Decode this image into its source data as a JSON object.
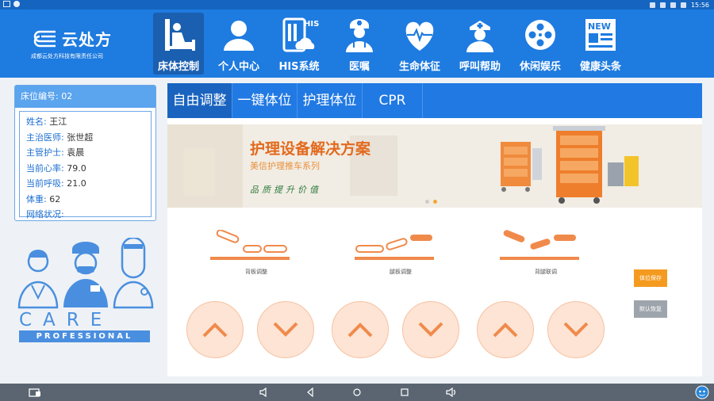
{
  "status_bar": {
    "time": "15:56"
  },
  "app": {
    "title": "云处方",
    "subtitle": "成都云处方科技有限责任公司"
  },
  "nav": [
    {
      "label": "床体控制",
      "icon": "bed-icon",
      "active": true
    },
    {
      "label": "个人中心",
      "icon": "user-icon",
      "active": false
    },
    {
      "label": "HIS系统",
      "icon": "his-icon",
      "active": false
    },
    {
      "label": "医嘱",
      "icon": "doctor-icon",
      "active": false
    },
    {
      "label": "生命体征",
      "icon": "heartbeat-icon",
      "active": false
    },
    {
      "label": "呼叫帮助",
      "icon": "nurse-icon",
      "active": false
    },
    {
      "label": "休闲娱乐",
      "icon": "film-reel-icon",
      "active": false
    },
    {
      "label": "健康头条",
      "icon": "news-icon",
      "active": false
    }
  ],
  "bed_info": {
    "header": "床位编号: 02",
    "rows": [
      {
        "key": "姓名:",
        "value": "王江"
      },
      {
        "key": "主治医师:",
        "value": "张世超"
      },
      {
        "key": "主管护士:",
        "value": "袁晨"
      },
      {
        "key": "当前心率:",
        "value": "79.0"
      },
      {
        "key": "当前呼吸:",
        "value": "21.0"
      },
      {
        "key": "体重:",
        "value": "62"
      },
      {
        "key": "网络状况:",
        "value": ""
      }
    ]
  },
  "care": {
    "word": "CARE",
    "sub": "PROFESSIONAL"
  },
  "tabs": [
    {
      "label": "自由调整",
      "active": true
    },
    {
      "label": "一键体位",
      "active": false
    },
    {
      "label": "护理体位",
      "active": false
    },
    {
      "label": "CPR",
      "active": false
    }
  ],
  "banner": {
    "title": "护理设备解决方案",
    "subtitle": "美信护理推车系列",
    "slogan": "品质提升价值"
  },
  "postures": [
    {
      "label": "背板调整"
    },
    {
      "label": "腿板调整"
    },
    {
      "label": "背腿联调"
    }
  ],
  "buttons": {
    "save": "体位保存",
    "reset": "默认恢复"
  },
  "colors": {
    "primary": "#1e7be0",
    "accent": "#f08a4b",
    "save": "#f49b1f"
  }
}
